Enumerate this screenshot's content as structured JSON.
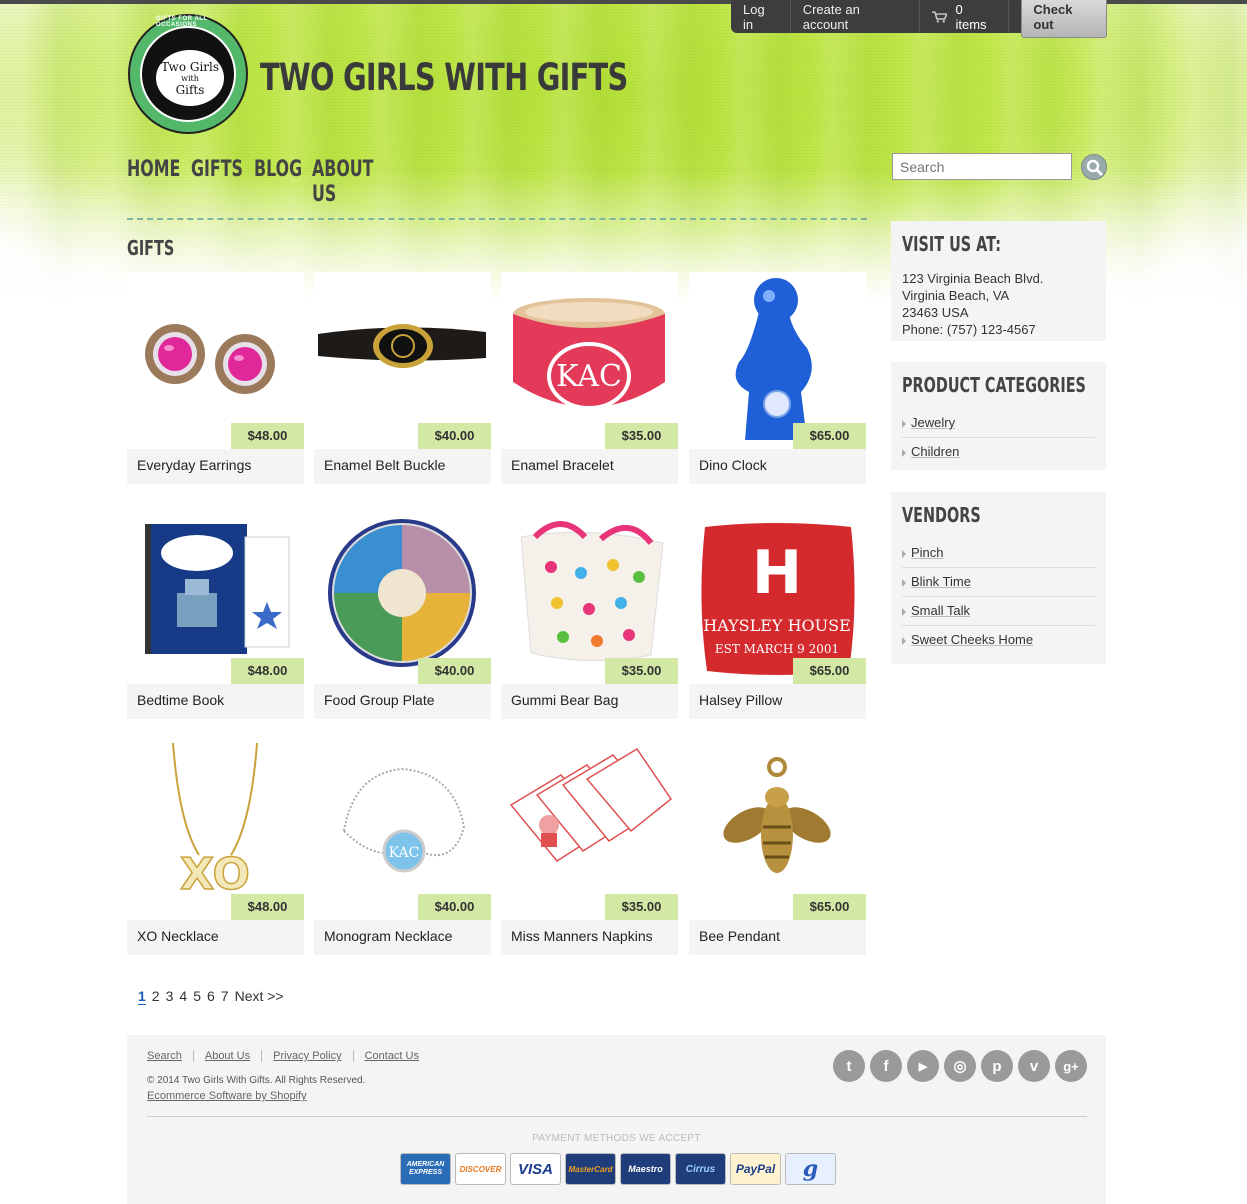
{
  "colors": {
    "green_bg": "#c2e84c",
    "price_tag": "#d3e8a4",
    "card_bg": "#f4f4f4",
    "account_bar": "#3d3d3d",
    "current_page": "#1a5fb4"
  },
  "account": {
    "login": "Log in",
    "create": "Create an account",
    "cart": "0 items",
    "checkout": "Check out"
  },
  "logo": {
    "ring_text": "GIFTS FOR ALL OCCASIONS",
    "line1": "Two Girls",
    "line2": "with",
    "line3": "Gifts"
  },
  "site_title": "TWO GIRLS WITH GIFTS",
  "nav": [
    "HOME",
    "GIFTS",
    "BLOG",
    "ABOUT US"
  ],
  "search": {
    "placeholder": "Search"
  },
  "page_title": "GIFTS",
  "products": [
    {
      "name": "Everyday Earrings",
      "price": "$48.00",
      "art": "earrings"
    },
    {
      "name": "Enamel Belt Buckle",
      "price": "$40.00",
      "art": "belt"
    },
    {
      "name": "Enamel Bracelet",
      "price": "$35.00",
      "art": "bracelet"
    },
    {
      "name": "Dino Clock",
      "price": "$65.00",
      "art": "dino"
    },
    {
      "name": "Bedtime Book",
      "price": "$48.00",
      "art": "book"
    },
    {
      "name": "Food Group Plate",
      "price": "$40.00",
      "art": "plate"
    },
    {
      "name": "Gummi Bear Bag",
      "price": "$35.00",
      "art": "bag"
    },
    {
      "name": "Halsey Pillow",
      "price": "$65.00",
      "art": "pillow"
    },
    {
      "name": "XO Necklace",
      "price": "$48.00",
      "art": "xo"
    },
    {
      "name": "Monogram Necklace",
      "price": "$40.00",
      "art": "monogram"
    },
    {
      "name": "Miss Manners Napkins",
      "price": "$35.00",
      "art": "napkins"
    },
    {
      "name": "Bee Pendant",
      "price": "$65.00",
      "art": "bee"
    }
  ],
  "pillow": {
    "letter": "H",
    "line1": "HAYSLEY HOUSE",
    "line2": "EST MARCH 9 2001"
  },
  "monogram_text": "KAC",
  "pagination": {
    "pages": [
      "1",
      "2",
      "3",
      "4",
      "5",
      "6",
      "7"
    ],
    "current": "1",
    "next": "Next >>"
  },
  "visit": {
    "heading": "VISIT US AT:",
    "address_line1": "123 Virginia Beach Blvd.",
    "address_line2": "Virginia Beach, VA",
    "address_line3": "23463 USA",
    "phone": "Phone: (757) 123-4567"
  },
  "categories": {
    "heading": "PRODUCT CATEGORIES",
    "items": [
      "Jewelry",
      "Children"
    ]
  },
  "vendors": {
    "heading": "VENDORS",
    "items": [
      "Pinch",
      "Blink Time",
      "Small Talk",
      "Sweet Cheeks Home"
    ]
  },
  "footer": {
    "links": [
      "Search",
      "About Us",
      "Privacy Policy",
      "Contact Us"
    ],
    "copyright": "© 2014 Two Girls With Gifts. All Rights Reserved.",
    "shopify": "Ecommerce Software by Shopify",
    "payment_label": "PAYMENT METHODS WE ACCEPT",
    "socials": [
      {
        "icon": "twitter-icon",
        "glyph": "t"
      },
      {
        "icon": "facebook-icon",
        "glyph": "f"
      },
      {
        "icon": "youtube-icon",
        "glyph": "▶"
      },
      {
        "icon": "instagram-icon",
        "glyph": "◎"
      },
      {
        "icon": "pinterest-icon",
        "glyph": "p"
      },
      {
        "icon": "vimeo-icon",
        "glyph": "v"
      },
      {
        "icon": "google-plus-icon",
        "glyph": "g+"
      }
    ],
    "payments": [
      {
        "label": "AMERICAN EXPRESS",
        "icon": "amex-icon",
        "bg": "#2a6cb5",
        "fg": "#ffffff"
      },
      {
        "label": "DISCOVER",
        "icon": "discover-icon",
        "bg": "#ffffff",
        "fg": "#e8781f"
      },
      {
        "label": "VISA",
        "icon": "visa-icon",
        "bg": "#ffffff",
        "fg": "#1a3d8f"
      },
      {
        "label": "MasterCard",
        "icon": "mastercard-icon",
        "bg": "#1f3d7a",
        "fg": "#f0a020"
      },
      {
        "label": "Maestro",
        "icon": "maestro-icon",
        "bg": "#1f3d7a",
        "fg": "#ffffff"
      },
      {
        "label": "Cirrus",
        "icon": "cirrus-icon",
        "bg": "#1f3d7a",
        "fg": "#9fd0ff"
      },
      {
        "label": "PayPal",
        "icon": "paypal-icon",
        "bg": "#fff3cf",
        "fg": "#1d3f8a"
      },
      {
        "label": "g",
        "icon": "google-checkout-icon",
        "bg": "#e8efff",
        "fg": "#2a5bb8"
      }
    ]
  }
}
